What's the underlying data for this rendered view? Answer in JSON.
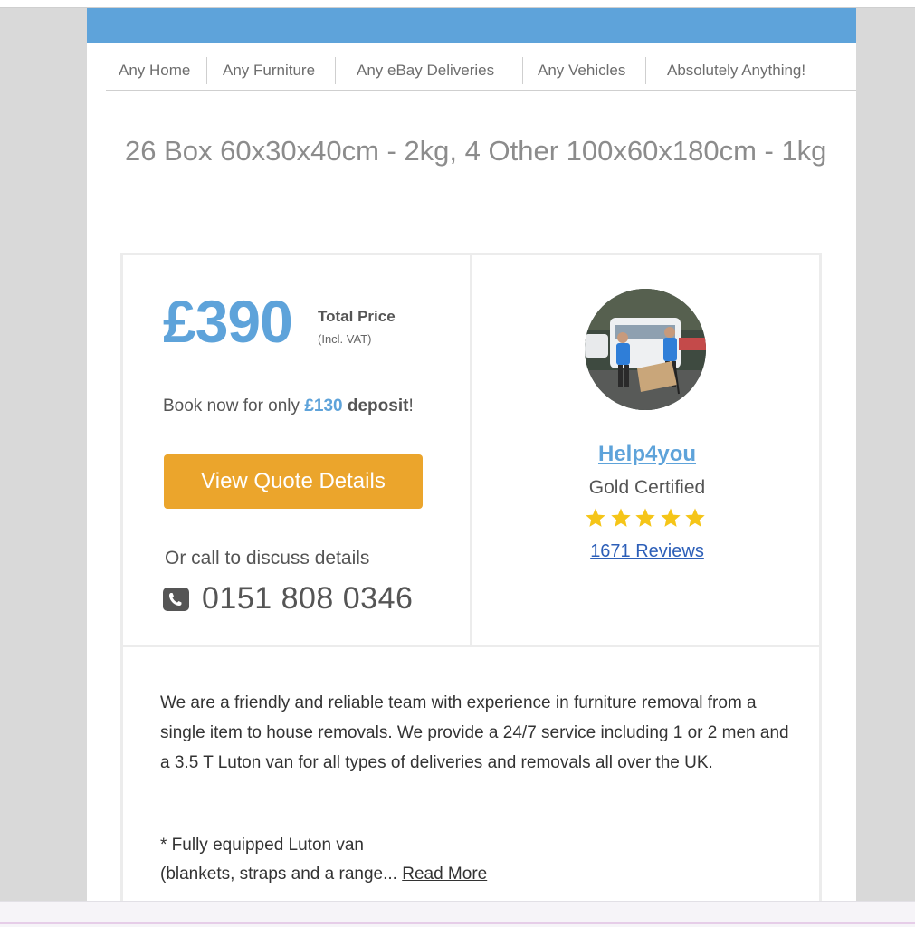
{
  "nav": {
    "items": [
      "Any Home",
      "Any Furniture",
      "Any eBay Deliveries",
      "Any Vehicles",
      "Absolutely Anything!"
    ]
  },
  "job": {
    "title": "26 Box 60x30x40cm - 2kg, 4 Other 100x60x180cm - 1kg"
  },
  "quote": {
    "price": "£390",
    "price_label": "Total Price",
    "price_sub": "(Incl. VAT)",
    "deposit_prefix": "Book now for only ",
    "deposit_amount": "£130",
    "deposit_word": "deposit",
    "deposit_suffix": "!",
    "button_label": "View Quote Details",
    "call_text": "Or call to discuss details",
    "phone": "0151 808 0346"
  },
  "provider": {
    "name": "Help4you",
    "certification": "Gold Certified",
    "rating": 5,
    "rating_max": 5,
    "reviews": "1671 Reviews"
  },
  "description": {
    "text": "We are a friendly and reliable team with experience in furniture removal from a single item to house removals. We provide a 24/7 service including 1 or 2 men and a 3.5 T Luton van for all types of deliveries and removals all over the UK.",
    "feature_line1": "* Fully equipped Luton van",
    "feature_line2": "(blankets, straps and a range... ",
    "read_more": "Read More"
  },
  "colors": {
    "accent_blue": "#5ea3da",
    "button_orange": "#eba52c",
    "star_yellow": "#f5c518",
    "link_blue": "#2d5fb8"
  },
  "icons": {
    "phone": "phone-icon",
    "star": "star-icon"
  }
}
